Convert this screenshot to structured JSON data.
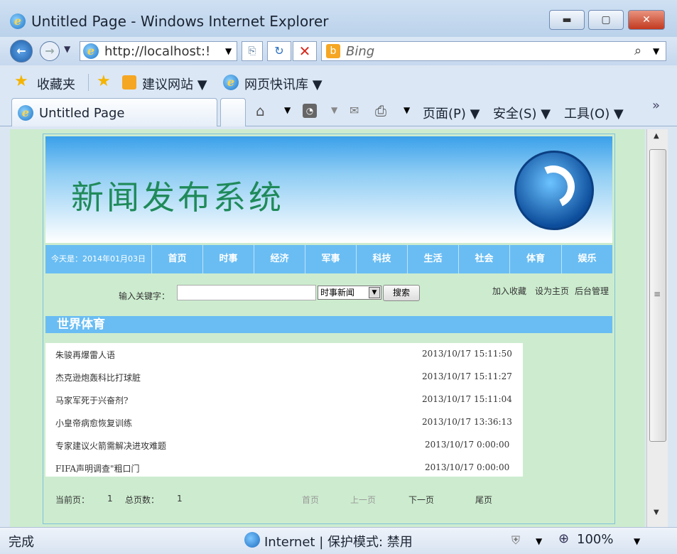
{
  "window": {
    "title": "Untitled Page - Windows Internet Explorer"
  },
  "address": {
    "url": "http://localhost:!",
    "search_placeholder": "Bing"
  },
  "favorites": {
    "label": "收藏夹",
    "suggested": "建议网站 ▼",
    "webslices": "网页快讯库 ▼"
  },
  "tab": {
    "title": "Untitled Page"
  },
  "commandbar": {
    "page": "页面(P) ▼",
    "safety": "安全(S) ▼",
    "tools": "工具(O) ▼",
    "more": "»"
  },
  "site": {
    "title": "新闻发布系统",
    "today": "今天是：2014年01月03日",
    "nav": [
      "首页",
      "时事",
      "经济",
      "军事",
      "科技",
      "生活",
      "社会",
      "体育",
      "娱乐"
    ],
    "search": {
      "label": "输入关键字：",
      "value": "",
      "select_value": "时事新闻",
      "button": "搜索"
    },
    "links": [
      "加入收藏",
      "设为主页",
      "后台管理"
    ],
    "section_title": "世界体育",
    "news": [
      {
        "title": "朱骏再爆雷人语",
        "date": "2013/10/17 15:11:50"
      },
      {
        "title": "杰克逊炮轰科比打球脏",
        "date": "2013/10/17 15:11:27"
      },
      {
        "title": "马家军死于兴奋剂?",
        "date": "2013/10/17 15:11:04"
      },
      {
        "title": "小皇帝病愈恢复训练",
        "date": "2013/10/17 13:36:13"
      },
      {
        "title": "专家建议火箭需解决进攻难题",
        "date": "2013/10/17 0:00:00"
      },
      {
        "title": "FIFA声明调查\"粗口门",
        "date": "2013/10/17 0:00:00"
      }
    ],
    "pager": {
      "current_label": "当前页：",
      "current": "1",
      "total_label": "总页数：",
      "total": "1",
      "first": "首页",
      "prev": "上一页",
      "next": "下一页",
      "last": "尾页"
    }
  },
  "status": {
    "left": "完成",
    "zone": "Internet | 保护模式: 禁用",
    "zoom": "100%"
  }
}
